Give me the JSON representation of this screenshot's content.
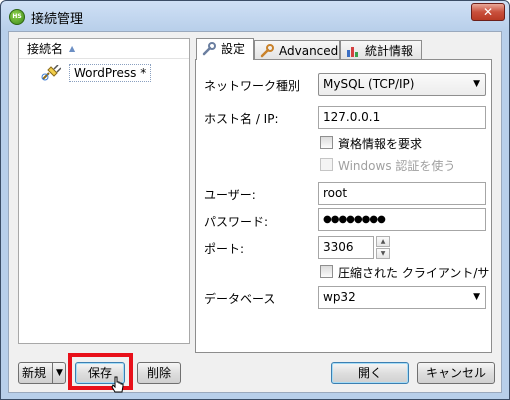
{
  "window": {
    "title": "接続管理",
    "app_icon_text": "HS",
    "close_label": "✕"
  },
  "list": {
    "header": "接続名",
    "items": [
      {
        "label": "WordPress *"
      }
    ]
  },
  "tabs": [
    {
      "label": "設定",
      "icon": "wrench-icon"
    },
    {
      "label": "Advanced",
      "icon": "wrench-icon"
    },
    {
      "label": "統計情報",
      "icon": "bar-chart-icon"
    }
  ],
  "settings": {
    "network_type_label": "ネットワーク種別",
    "network_type_value": "MySQL (TCP/IP)",
    "host_label": "ホスト名 / IP:",
    "host_value": "127.0.0.1",
    "request_credentials_label": "資格情報を要求",
    "windows_auth_label": "Windows 認証を使う",
    "user_label": "ユーザー:",
    "user_value": "root",
    "password_label": "パスワード:",
    "password_value": "●●●●●●●●",
    "port_label": "ポート:",
    "port_value": "3306",
    "compressed_label": "圧縮された クライアント/サ",
    "database_label": "データベース",
    "database_value": "wp32"
  },
  "buttons": {
    "new": "新規",
    "save": "保存",
    "delete": "削除",
    "open": "開く",
    "cancel": "キャンセル"
  },
  "colors": {
    "highlight": "#e8101a",
    "title_bar": "#b8cfea"
  }
}
